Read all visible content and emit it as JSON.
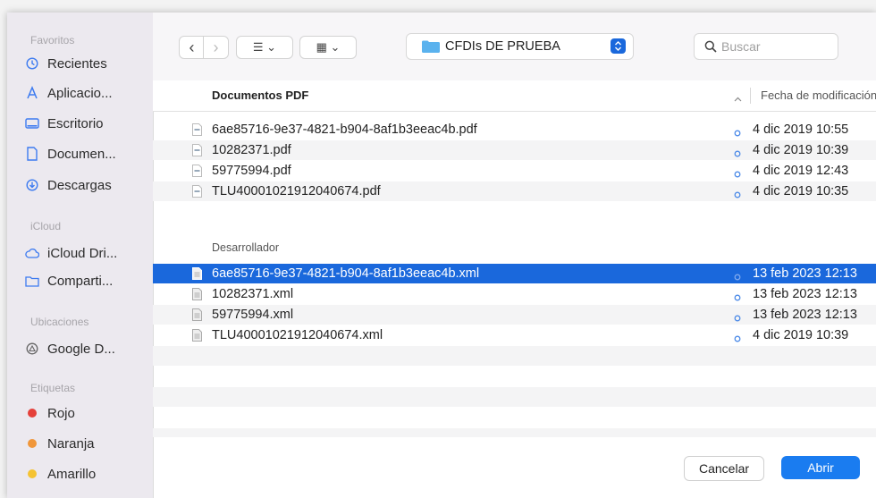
{
  "sidebar": {
    "favorites_title": "Favoritos",
    "favorites": [
      {
        "label": "Recientes",
        "icon": "clock-icon"
      },
      {
        "label": "Aplicacio...",
        "icon": "applications-icon"
      },
      {
        "label": "Escritorio",
        "icon": "desktop-icon"
      },
      {
        "label": "Documen...",
        "icon": "document-icon"
      },
      {
        "label": "Descargas",
        "icon": "download-icon"
      }
    ],
    "icloud_title": "iCloud",
    "icloud": [
      {
        "label": "iCloud Dri...",
        "icon": "cloud-icon"
      },
      {
        "label": "Comparti...",
        "icon": "shared-folder-icon"
      }
    ],
    "locations_title": "Ubicaciones",
    "locations": [
      {
        "label": "Google D...",
        "icon": "drive-icon"
      }
    ],
    "tags_title": "Etiquetas",
    "tags": [
      {
        "label": "Rojo",
        "color": "#e5403a"
      },
      {
        "label": "Naranja",
        "color": "#f0963a"
      },
      {
        "label": "Amarillo",
        "color": "#f5c332"
      }
    ]
  },
  "toolbar": {
    "back": "‹",
    "forward": "›",
    "list_view": "☰ ⌄",
    "grid_view": "▦ ⌄",
    "folder_name": "CFDIs DE PRUEBA",
    "search_placeholder": "Buscar"
  },
  "columns": {
    "name": "Documentos PDF",
    "date": "Fecha de modificación"
  },
  "groups": {
    "developer": "Desarrollador"
  },
  "pdf_files": [
    {
      "name": "6ae85716-9e37-4821-b904-8af1b3eeac4b.pdf",
      "date": "4 dic 2019 10:55"
    },
    {
      "name": "10282371.pdf",
      "date": "4 dic 2019 10:39"
    },
    {
      "name": "59775994.pdf",
      "date": "4 dic 2019 12:43"
    },
    {
      "name": "TLU40001021912040674.pdf",
      "date": "4 dic 2019 10:35"
    }
  ],
  "xml_files": [
    {
      "name": "6ae85716-9e37-4821-b904-8af1b3eeac4b.xml",
      "date": "13 feb 2023 12:13"
    },
    {
      "name": "10282371.xml",
      "date": "13 feb 2023 12:13"
    },
    {
      "name": "59775994.xml",
      "date": "13 feb 2023 12:13"
    },
    {
      "name": "TLU40001021912040674.xml",
      "date": "4 dic 2019 10:39"
    }
  ],
  "buttons": {
    "cancel": "Cancelar",
    "open": "Abrir"
  },
  "colors": {
    "accent": "#1a68dc",
    "folder": "#5ab2ee"
  }
}
